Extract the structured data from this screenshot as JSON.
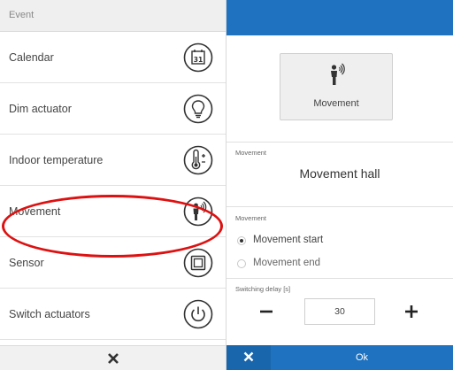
{
  "event_panel": {
    "header": "Event",
    "items": [
      {
        "label": "Calendar",
        "icon": "calendar-icon",
        "icon_text": "31"
      },
      {
        "label": "Dim actuator",
        "icon": "lightbulb-icon"
      },
      {
        "label": "Indoor temperature",
        "icon": "thermometer-icon"
      },
      {
        "label": "Movement",
        "icon": "movement-icon"
      },
      {
        "label": "Sensor",
        "icon": "sensor-icon"
      },
      {
        "label": "Switch actuators",
        "icon": "power-icon"
      }
    ],
    "highlighted_item": "Movement",
    "footer_close": "close-icon"
  },
  "detail_panel": {
    "tile_label": "Movement",
    "name_caption": "Movement",
    "device_name": "Movement hall",
    "mode_caption": "Movement",
    "options": [
      {
        "label": "Movement start",
        "selected": true
      },
      {
        "label": "Movement end",
        "selected": false
      }
    ],
    "delay_caption": "Switching delay [s]",
    "delay_value": "30",
    "ok_label": "Ok"
  },
  "colors": {
    "accent": "#1e72bf",
    "highlight": "#dd1111"
  }
}
